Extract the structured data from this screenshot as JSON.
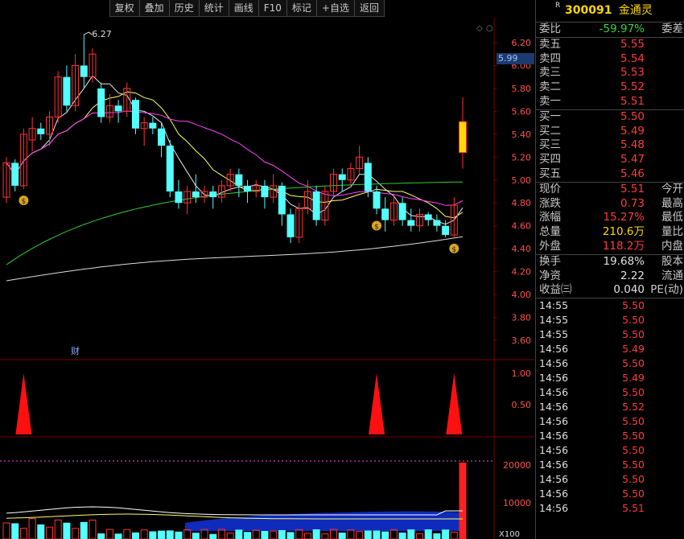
{
  "toolbar": [
    "复权",
    "叠加",
    "历史",
    "统计",
    "画线",
    "F10",
    "标记",
    "+自选",
    "返回"
  ],
  "chart": {
    "price_axis": [
      "6.20",
      "6.00",
      "5.80",
      "5.60",
      "5.40",
      "5.20",
      "5.00",
      "4.80",
      "4.60",
      "4.40",
      "4.20",
      "4.00",
      "3.80",
      "3.60"
    ],
    "current_price_tag": "5.99",
    "high_label": "6.27",
    "finance_marker": "财",
    "signal_axis": [
      "1.00",
      "0.50"
    ],
    "volume_axis": [
      "20000",
      "10000"
    ],
    "volume_unit": "X100",
    "candles": [
      [
        4.85,
        5.15,
        4.8,
        5.2
      ],
      [
        5.15,
        4.95,
        4.9,
        5.18
      ],
      [
        4.95,
        5.4,
        4.92,
        5.45
      ],
      [
        5.35,
        5.45,
        5.25,
        5.55
      ],
      [
        5.45,
        5.4,
        5.35,
        5.5
      ],
      [
        5.4,
        5.55,
        5.3,
        5.6
      ],
      [
        5.55,
        5.9,
        5.5,
        5.95
      ],
      [
        5.9,
        5.65,
        5.6,
        6.0
      ],
      [
        5.65,
        6.0,
        5.6,
        6.1
      ],
      [
        6.0,
        5.9,
        5.8,
        6.27
      ],
      [
        5.9,
        6.1,
        5.85,
        6.15
      ],
      [
        5.8,
        5.55,
        5.5,
        5.85
      ],
      [
        5.55,
        5.65,
        5.5,
        5.75
      ],
      [
        5.65,
        5.6,
        5.5,
        5.7
      ],
      [
        5.6,
        5.8,
        5.55,
        5.85
      ],
      [
        5.7,
        5.45,
        5.4,
        5.72
      ],
      [
        5.45,
        5.5,
        5.3,
        5.55
      ],
      [
        5.5,
        5.45,
        5.4,
        5.55
      ],
      [
        5.45,
        5.3,
        5.2,
        5.5
      ],
      [
        5.3,
        4.9,
        4.85,
        5.35
      ],
      [
        4.9,
        4.8,
        4.75,
        5.0
      ],
      [
        4.8,
        4.9,
        4.7,
        4.95
      ],
      [
        4.9,
        4.85,
        4.8,
        5.05
      ],
      [
        4.85,
        4.9,
        4.8,
        4.95
      ],
      [
        4.9,
        4.85,
        4.75,
        4.95
      ],
      [
        4.85,
        4.95,
        4.8,
        5.0
      ],
      [
        4.95,
        5.05,
        4.9,
        5.1
      ],
      [
        5.05,
        4.95,
        4.85,
        5.1
      ],
      [
        4.95,
        4.9,
        4.8,
        5.0
      ],
      [
        4.9,
        4.95,
        4.85,
        5.0
      ],
      [
        4.95,
        4.85,
        4.75,
        5.0
      ],
      [
        4.85,
        4.95,
        4.8,
        5.05
      ],
      [
        4.95,
        4.7,
        4.6,
        4.98
      ],
      [
        4.7,
        4.5,
        4.45,
        4.75
      ],
      [
        4.5,
        4.75,
        4.45,
        4.8
      ],
      [
        4.75,
        4.9,
        4.7,
        5.0
      ],
      [
        4.9,
        4.65,
        4.6,
        4.95
      ],
      [
        4.65,
        4.9,
        4.6,
        4.95
      ],
      [
        4.9,
        5.05,
        4.85,
        5.1
      ],
      [
        5.05,
        5.0,
        4.9,
        5.1
      ],
      [
        5.0,
        5.1,
        4.95,
        5.15
      ],
      [
        5.1,
        5.2,
        5.05,
        5.3
      ],
      [
        5.15,
        4.9,
        4.85,
        5.2
      ],
      [
        4.9,
        4.75,
        4.7,
        4.95
      ],
      [
        4.75,
        4.65,
        4.55,
        4.85
      ],
      [
        4.65,
        4.8,
        4.6,
        4.85
      ],
      [
        4.8,
        4.65,
        4.6,
        4.85
      ],
      [
        4.65,
        4.6,
        4.55,
        4.75
      ],
      [
        4.6,
        4.7,
        4.55,
        4.75
      ],
      [
        4.7,
        4.65,
        4.6,
        4.72
      ],
      [
        4.65,
        4.6,
        4.55,
        4.7
      ],
      [
        4.6,
        4.52,
        4.5,
        4.65
      ],
      [
        4.52,
        4.78,
        4.5,
        4.85
      ],
      [
        5.51,
        5.24,
        5.1,
        5.72
      ]
    ],
    "signals": [
      2,
      43,
      52
    ]
  },
  "quote": {
    "code": "300091",
    "name": "金通灵",
    "weibi_label": "委比",
    "weibi_value": "-59.97%",
    "weicha_label": "委差",
    "asks": [
      {
        "label": "卖五",
        "price": "5.55"
      },
      {
        "label": "卖四",
        "price": "5.54"
      },
      {
        "label": "卖三",
        "price": "5.53"
      },
      {
        "label": "卖二",
        "price": "5.52"
      },
      {
        "label": "卖一",
        "price": "5.51"
      }
    ],
    "bids": [
      {
        "label": "买一",
        "price": "5.50"
      },
      {
        "label": "买二",
        "price": "5.49"
      },
      {
        "label": "买三",
        "price": "5.48"
      },
      {
        "label": "买四",
        "price": "5.47"
      },
      {
        "label": "买五",
        "price": "5.46"
      }
    ],
    "stats1": [
      {
        "label": "现价",
        "value": "5.51",
        "label2": "今开",
        "cls": "red"
      },
      {
        "label": "涨跌",
        "value": "0.73",
        "label2": "最高",
        "cls": "red"
      },
      {
        "label": "涨幅",
        "value": "15.27%",
        "label2": "最低",
        "cls": "red"
      },
      {
        "label": "总量",
        "value": "210.6万",
        "label2": "量比",
        "cls": "yel"
      },
      {
        "label": "外盘",
        "value": "118.2万",
        "label2": "内盘",
        "cls": "red"
      }
    ],
    "stats2": [
      {
        "label": "换手",
        "value": "19.68%",
        "label2": "股本",
        "cls": "white"
      },
      {
        "label": "净资",
        "value": "2.22",
        "label2": "流通",
        "cls": "white"
      },
      {
        "label": "收益㈢",
        "value": "0.040",
        "label2": "PE(动)",
        "cls": "white"
      }
    ],
    "ticks": [
      {
        "time": "14:55",
        "price": "5.50"
      },
      {
        "time": "14:55",
        "price": "5.50"
      },
      {
        "time": "14:55",
        "price": "5.50"
      },
      {
        "time": "14:56",
        "price": "5.49"
      },
      {
        "time": "14:56",
        "price": "5.50"
      },
      {
        "time": "14:56",
        "price": "5.49"
      },
      {
        "time": "14:56",
        "price": "5.50"
      },
      {
        "time": "14:56",
        "price": "5.52"
      },
      {
        "time": "14:56",
        "price": "5.50"
      },
      {
        "time": "14:56",
        "price": "5.50"
      },
      {
        "time": "14:56",
        "price": "5.50"
      },
      {
        "time": "14:56",
        "price": "5.50"
      },
      {
        "time": "14:56",
        "price": "5.50"
      },
      {
        "time": "14:56",
        "price": "5.50"
      },
      {
        "time": "14:56",
        "price": "5.51"
      }
    ]
  }
}
